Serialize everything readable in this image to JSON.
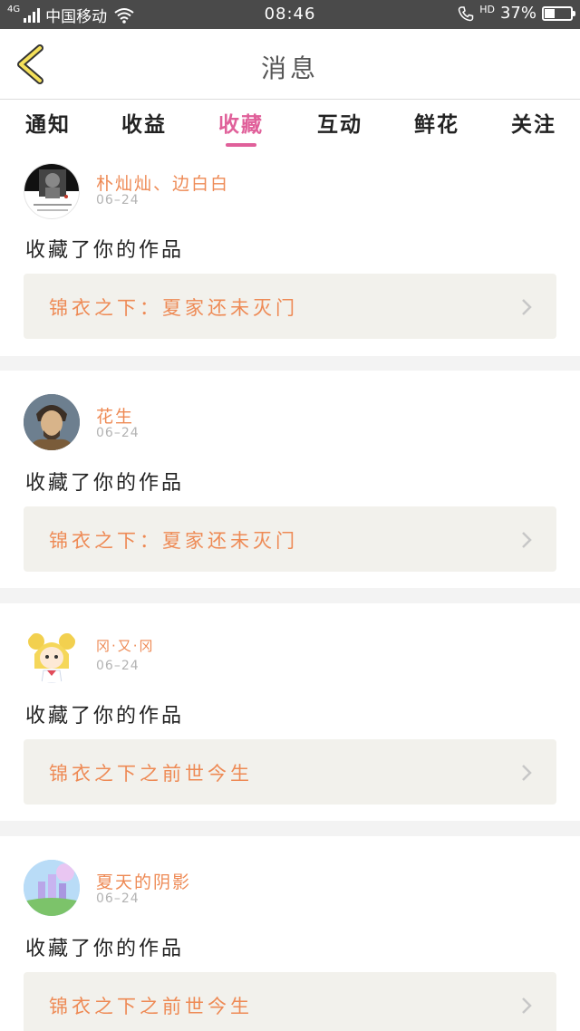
{
  "status_bar": {
    "network": "4G",
    "carrier": "中国移动",
    "time": "08:46",
    "hd": "HD",
    "battery": "37%",
    "battery_level": 0.37
  },
  "header": {
    "title": "消息"
  },
  "tabs": [
    {
      "label": "通知",
      "active": false
    },
    {
      "label": "收益",
      "active": false
    },
    {
      "label": "收藏",
      "active": true
    },
    {
      "label": "互动",
      "active": false
    },
    {
      "label": "鲜花",
      "active": false
    },
    {
      "label": "关注",
      "active": false
    }
  ],
  "messages": [
    {
      "user": "朴灿灿、边白白",
      "date": "06–24",
      "action": "收藏了你的作品",
      "work": "锦衣之下：夏家还未灭门",
      "avatar": "avatar-photo-dark"
    },
    {
      "user": "花生",
      "date": "06–24",
      "action": "收藏了你的作品",
      "work": "锦衣之下：夏家还未灭门",
      "avatar": "avatar-portrait"
    },
    {
      "user": "冈·又·冈",
      "date": "06–24",
      "action": "收藏了你的作品",
      "work": "锦衣之下之前世今生",
      "avatar": "avatar-cartoon"
    },
    {
      "user": "夏天的阴影",
      "date": "06–24",
      "action": "收藏了你的作品",
      "work": "锦衣之下之前世今生",
      "avatar": "avatar-castle"
    }
  ],
  "colors": {
    "accent_pink": "#e0609a",
    "accent_orange": "#ee8a55",
    "status_bar": "#4a4a4a",
    "work_bg": "#f2f1ec"
  }
}
